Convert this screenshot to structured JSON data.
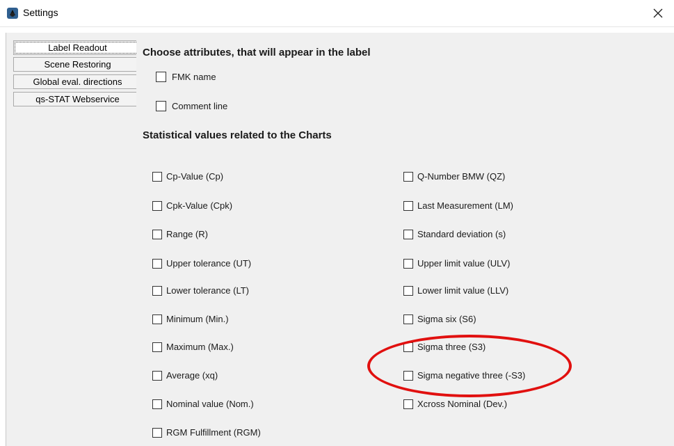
{
  "window": {
    "title": "Settings",
    "icon": "settings-app-icon",
    "close_icon": "close-icon"
  },
  "sidebar": {
    "items": [
      {
        "label": "Label Readout",
        "selected": true
      },
      {
        "label": "Scene Restoring"
      },
      {
        "label": "Global eval. directions"
      },
      {
        "label": "qs-STAT Webservice"
      }
    ]
  },
  "main": {
    "label_section": {
      "heading": "Choose attributes, that will appear in the label",
      "options": [
        {
          "label": "FMK name",
          "checked": false
        },
        {
          "label": "Comment line",
          "checked": false
        }
      ]
    },
    "stats_section": {
      "heading": "Statistical values related to the Charts",
      "left_options": [
        {
          "label": "Cp-Value (Cp)",
          "checked": false
        },
        {
          "label": "Cpk-Value (Cpk)",
          "checked": false
        },
        {
          "label": "Range (R)",
          "checked": false
        },
        {
          "label": "Upper tolerance (UT)",
          "checked": false
        },
        {
          "label": "Lower tolerance (LT)",
          "checked": false
        },
        {
          "label": "Minimum (Min.)",
          "checked": false
        },
        {
          "label": "Maximum (Max.)",
          "checked": false
        },
        {
          "label": "Average (xq)",
          "checked": false
        },
        {
          "label": "Nominal value (Nom.)",
          "checked": false
        },
        {
          "label": "RGM Fulfillment (RGM)",
          "checked": false
        }
      ],
      "right_options": [
        {
          "label": "Q-Number BMW (QZ)",
          "checked": false
        },
        {
          "label": "Last Measurement (LM)",
          "checked": false
        },
        {
          "label": "Standard deviation (s)",
          "checked": false
        },
        {
          "label": "Upper limit value (ULV)",
          "checked": false
        },
        {
          "label": "Lower limit value (LLV)",
          "checked": false
        },
        {
          "label": "Sigma six (S6)",
          "checked": false
        },
        {
          "label": "Sigma three (S3)",
          "checked": false
        },
        {
          "label": "Sigma negative three (-S3)",
          "checked": false
        },
        {
          "label": "Xcross Nominal (Dev.)",
          "checked": false
        }
      ]
    }
  },
  "colors": {
    "highlight": "#e1100f",
    "panel_bg": "#f0f0f0"
  }
}
